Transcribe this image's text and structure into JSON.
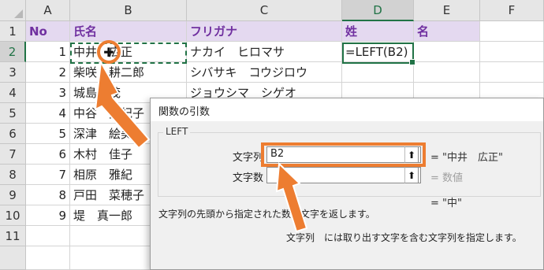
{
  "columns": [
    "A",
    "B",
    "C",
    "D",
    "E",
    "F"
  ],
  "rows": [
    "1",
    "2",
    "3",
    "4",
    "5",
    "6",
    "7",
    "8",
    "9",
    "10",
    "11"
  ],
  "header_row": {
    "no": "No",
    "name": "氏名",
    "furigana": "フリガナ",
    "sei": "姓",
    "mei": "名"
  },
  "data_rows": [
    {
      "no": "1",
      "name": "中井　広正",
      "furigana": "ナカイ　ヒロマサ"
    },
    {
      "no": "2",
      "name": "柴咲　耕二郎",
      "furigana": "シバサキ　コウジロウ"
    },
    {
      "no": "3",
      "name": "城島　茂",
      "furigana": "ジョウシマ　シゲオ"
    },
    {
      "no": "4",
      "name": "中谷　美紀子",
      "furigana": ""
    },
    {
      "no": "5",
      "name": "深津　絵美",
      "furigana": ""
    },
    {
      "no": "6",
      "name": "木村　佳子",
      "furigana": ""
    },
    {
      "no": "7",
      "name": "相原　雅紀",
      "furigana": ""
    },
    {
      "no": "8",
      "name": "戸田　菜穂子",
      "furigana": ""
    },
    {
      "no": "9",
      "name": "堤　真一郎",
      "furigana": ""
    }
  ],
  "formula_cell": "=LEFT(B2)",
  "dialog": {
    "title": "関数の引数",
    "function_name": "LEFT",
    "arg1_label": "文字列",
    "arg1_value": "B2",
    "arg1_result": "= \"中井　広正\"",
    "arg2_label": "文字数",
    "arg2_value": "",
    "arg2_result": "= 数値",
    "formula_result": "= \"中\"",
    "description": "文字列の先頭から指定された数の文字を返します。",
    "arg_description": "文字列　には取り出す文字を含む文字列を指定します。"
  },
  "colors": {
    "accent_orange": "#ed7d31",
    "excel_green": "#217346",
    "header_fill": "#e4d9f0",
    "header_text": "#7030a0"
  },
  "icons": [
    "collapse-dialog-icon",
    "cursor-cross-icon",
    "arrow-pointer-icon"
  ]
}
